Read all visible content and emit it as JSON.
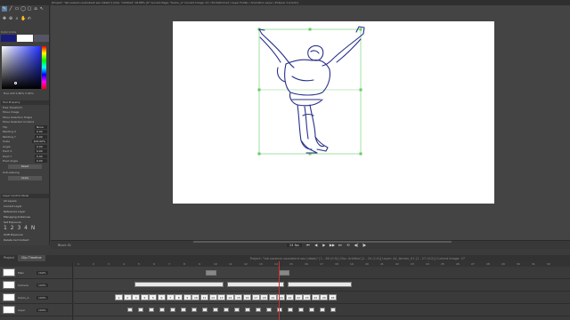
{
  "titlebar": {
    "text": "[Project: \"lab sozenzu sozzubent sez (dbab)\"] [Clip: \"Untitled\" 18.88% (0°  Current Page: \"Sozou_A\"  Current Image: 27 / 59  Deformed /  Layer Folder / Animation Layer / Eclipse: Current:]"
  },
  "tools": {
    "icons": [
      "✎",
      "╱",
      "▭",
      "◯",
      "▢",
      "⌂",
      "↖",
      "✥",
      "⊕",
      "⌕",
      "✋",
      "✍"
    ]
  },
  "color_panel": {
    "header": "Color Circle",
    "value_text": "Hue 220  S 80%  V 60%",
    "foreground": "#1a1a7a",
    "background": "#ffffff"
  },
  "transform_panel": {
    "header": "Tool Property",
    "title": "Free Transform",
    "rows": [
      {
        "label": "Move Image",
        "value": ""
      },
      {
        "label": "Move Selection Shape",
        "value": ""
      },
      {
        "label": "Move Selected Content",
        "value": ""
      },
      {
        "label": "Flip",
        "value": "None"
      },
      {
        "label": "Painting X",
        "value": "0.00"
      },
      {
        "label": "Painting Y",
        "value": "0.00"
      },
      {
        "label": "Scale",
        "value": "100.00%"
      },
      {
        "label": "Angle",
        "value": "0.00"
      },
      {
        "label": "Pivot X",
        "value": "0.00"
      },
      {
        "label": "Pivot Y",
        "value": "0.00"
      },
      {
        "label": "Pivot Angle",
        "value": "0.00"
      }
    ],
    "reset_label": "Reset",
    "antialias_label": "Anti-aliasing",
    "apply_label": "Apply"
  },
  "layer_panel": {
    "header": "Layer Control Panel",
    "rows": [
      "All Layers",
      "Current Layer",
      "Reference Layer",
      "Managing Instances",
      "Set Exposure"
    ],
    "counter": "1 2 3 4 N",
    "extra": [
      "Shift Exposure",
      "Delete Cel Content"
    ]
  },
  "timeline_bar": {
    "frame_label": "Block 01",
    "fps": "24 fps",
    "controls": [
      "⏮",
      "◀",
      "▶",
      "▶▶",
      "⏭",
      "⟲",
      "◀|",
      "|▶"
    ]
  },
  "tabs": {
    "items": [
      "Project",
      "Clip Timeline"
    ],
    "info": "Project: \"lab sozenzu sozzubent sez (dbab)\"  [1 - 60 (0:5)]    Clip: Untitled  [1 - 24 (1:0)]    Layer: A1_terrain_01  [1 - 27 (0:2)]    Current Image: 27"
  },
  "tracks": [
    {
      "name": "Main",
      "pct": "100%"
    },
    {
      "name": "Camera",
      "pct": "100%"
    },
    {
      "name": "Sozou_A",
      "pct": "100%"
    },
    {
      "name": "Layer",
      "pct": "100%"
    }
  ],
  "ruler": [
    "1",
    "2",
    "3",
    "4",
    "5",
    "6",
    "7",
    "8",
    "9",
    "10",
    "11",
    "12",
    "13",
    "14",
    "15",
    "16",
    "17",
    "18",
    "19",
    "20",
    "21",
    "22",
    "23",
    "24",
    "25",
    "26",
    "27",
    "28",
    "29",
    "30",
    "31",
    "32"
  ],
  "cel_numbers": [
    "1",
    "2",
    "3",
    "4",
    "5",
    "6",
    "7",
    "8",
    "9",
    "10",
    "11",
    "12",
    "13",
    "14",
    "15",
    "16",
    "17",
    "18",
    "19",
    "20",
    "21",
    "22",
    "23",
    "24",
    "25",
    "26"
  ]
}
